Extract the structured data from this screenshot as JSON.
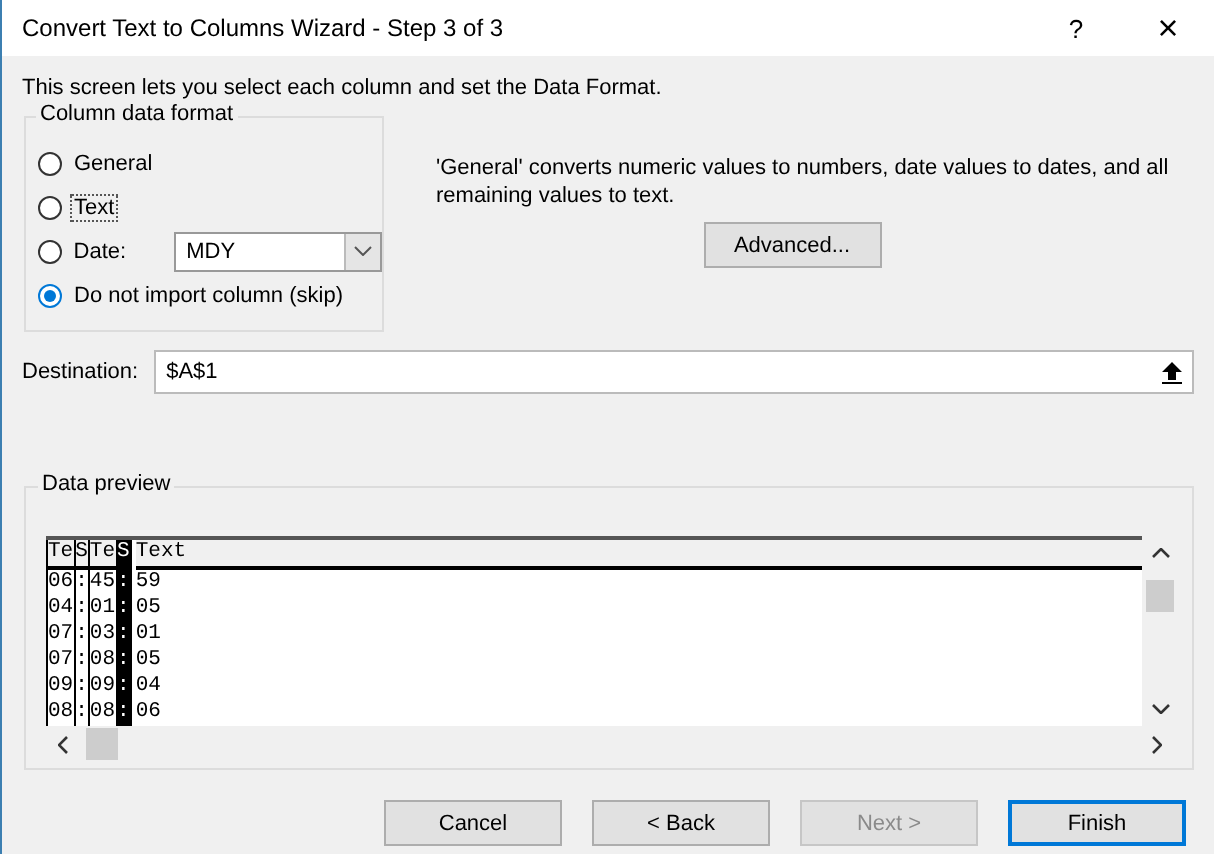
{
  "window": {
    "title": "Convert Text to Columns Wizard - Step 3 of 3",
    "help": "?",
    "close": "×"
  },
  "intro": "This screen lets you select each column and set the Data Format.",
  "column_data_format": {
    "legend": "Column data format",
    "options": [
      {
        "label": "General",
        "selected": false,
        "focused": false,
        "kind": "plain"
      },
      {
        "label": "Text",
        "selected": false,
        "focused": true,
        "kind": "plain"
      },
      {
        "label": "Date:",
        "selected": false,
        "focused": false,
        "kind": "date",
        "dropdown": "MDY"
      },
      {
        "label": "Do not import column (skip)",
        "selected": true,
        "focused": false,
        "kind": "plain"
      }
    ]
  },
  "description": "'General' converts numeric values to numbers, date values to dates, and all remaining values to text.",
  "advanced_button": "Advanced...",
  "destination": {
    "label": "Destination:",
    "value": "$A$1"
  },
  "data_preview": {
    "legend": "Data preview",
    "columns": [
      {
        "header": "Te",
        "selected": false
      },
      {
        "header": "S",
        "selected": false
      },
      {
        "header": "Te",
        "selected": false
      },
      {
        "header": "S",
        "selected": true
      },
      {
        "header": "Text",
        "selected": false
      }
    ],
    "rows": [
      [
        "06",
        ":",
        "45",
        ":",
        "59"
      ],
      [
        "04",
        ":",
        "01",
        ":",
        "05"
      ],
      [
        "07",
        ":",
        "03",
        ":",
        "01"
      ],
      [
        "07",
        ":",
        "08",
        ":",
        "05"
      ],
      [
        "09",
        ":",
        "09",
        ":",
        "04"
      ],
      [
        "08",
        ":",
        "08",
        ":",
        "06"
      ]
    ]
  },
  "buttons": [
    {
      "label": "Cancel",
      "disabled": false,
      "default": false
    },
    {
      "label": "< Back",
      "disabled": false,
      "default": false
    },
    {
      "label": "Next >",
      "disabled": true,
      "default": false
    },
    {
      "label": "Finish",
      "disabled": false,
      "default": true
    }
  ]
}
